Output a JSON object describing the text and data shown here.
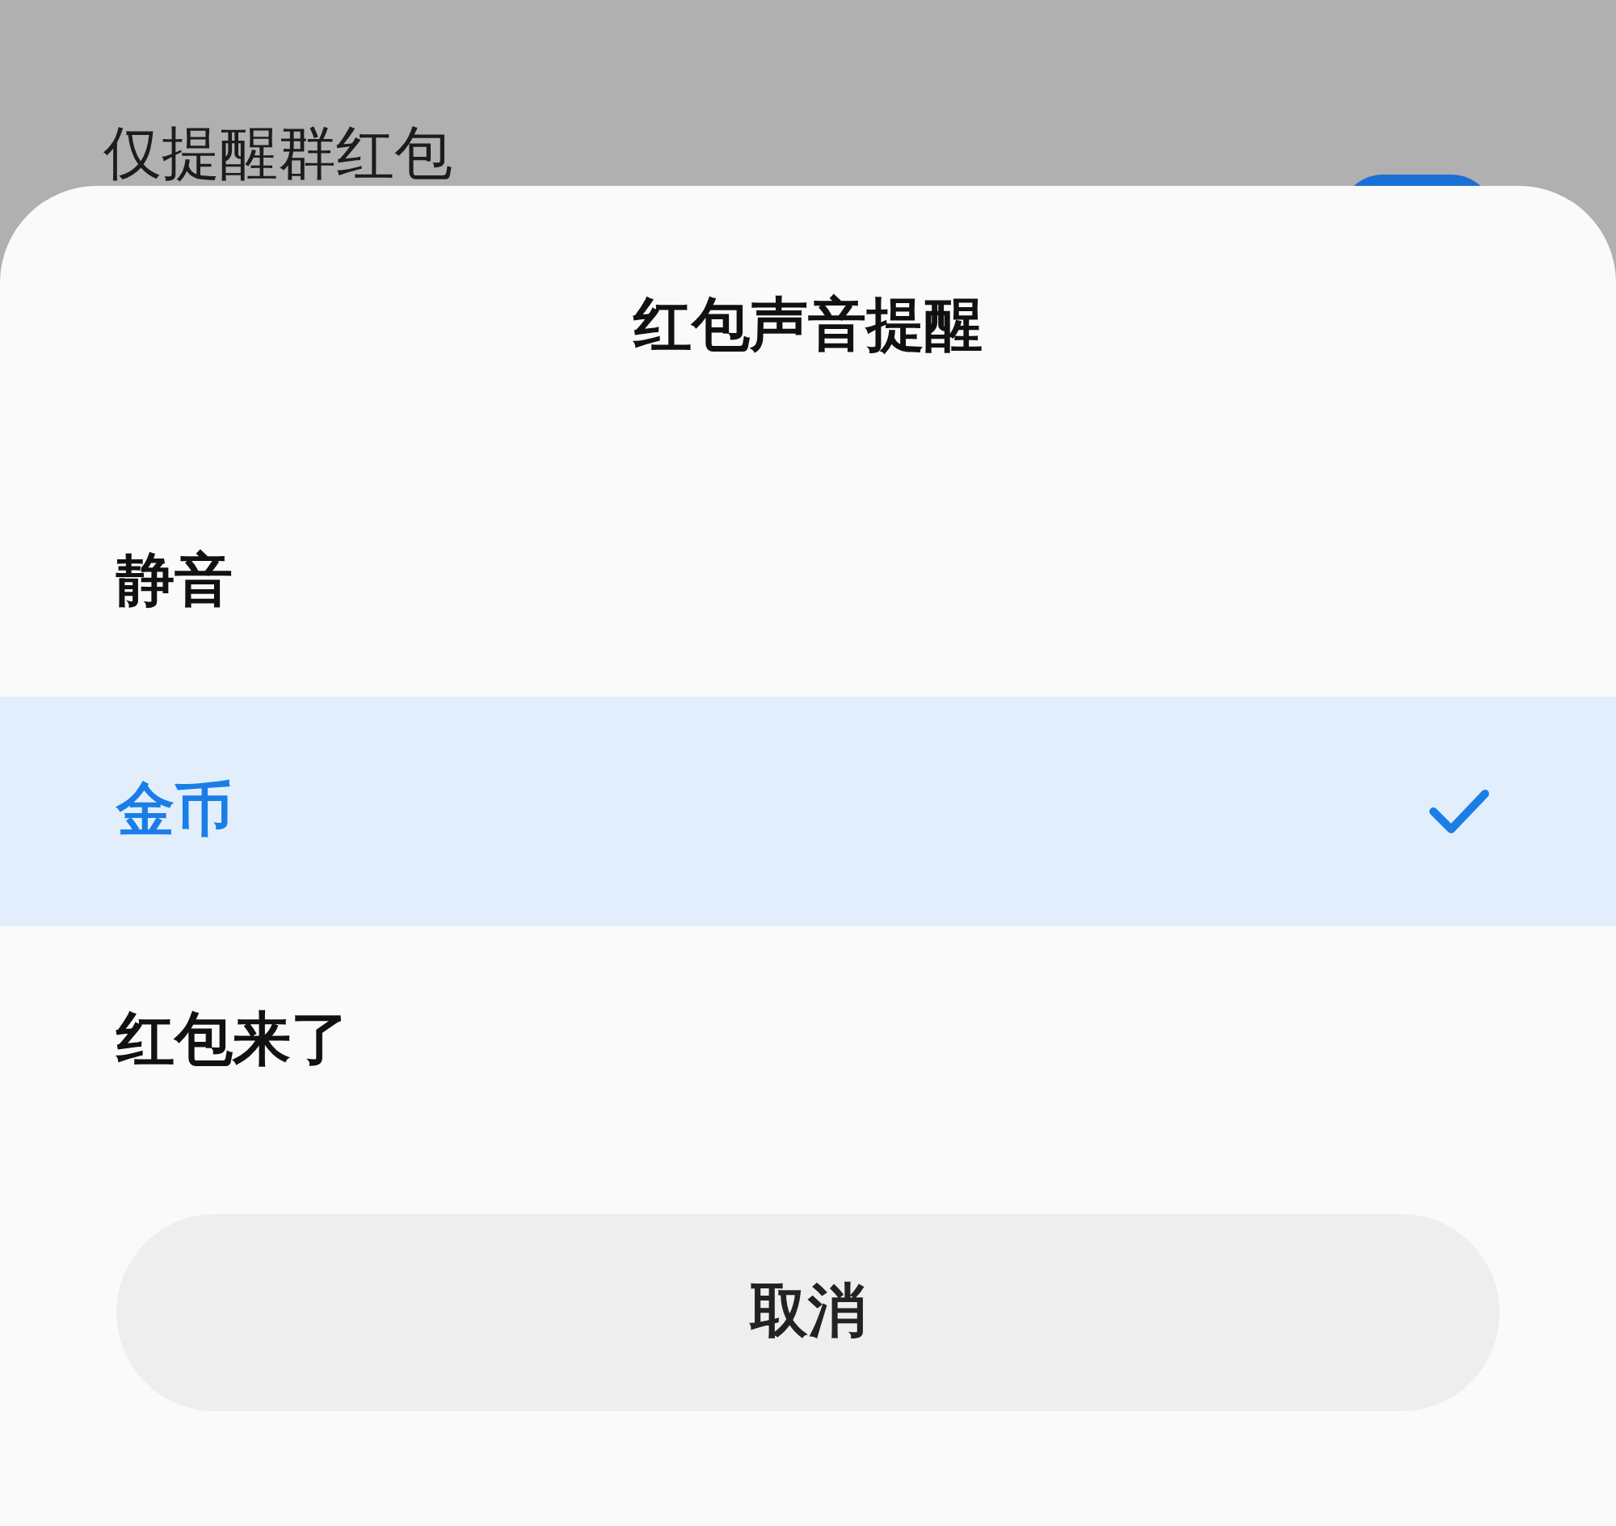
{
  "background_setting": {
    "label": "仅提醒群红包",
    "on": true
  },
  "sheet": {
    "title": "红包声音提醒",
    "options": [
      {
        "label": "静音",
        "selected": false
      },
      {
        "label": "金币",
        "selected": true
      },
      {
        "label": "红包来了",
        "selected": false
      }
    ],
    "cancel_button": "取消"
  }
}
